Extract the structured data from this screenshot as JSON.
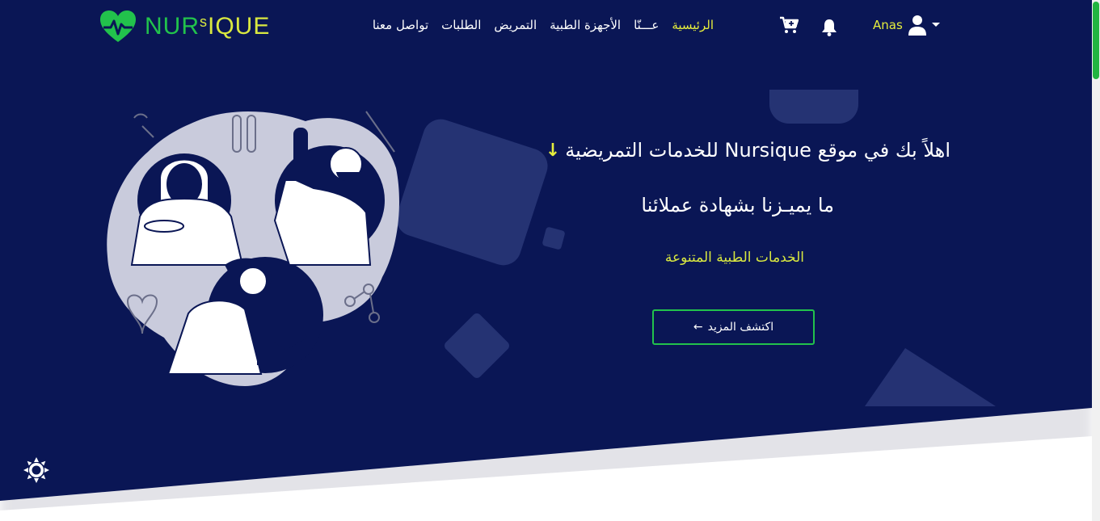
{
  "brand": {
    "name_part1": "NUR",
    "name_part2": "SIQUE",
    "name_s": "s"
  },
  "nav": {
    "links": [
      {
        "label": "الرئيسية",
        "active": true
      },
      {
        "label": "عـــنّا",
        "active": false
      },
      {
        "label": "الأجهزة الطبية",
        "active": false
      },
      {
        "label": "التمريض",
        "active": false
      },
      {
        "label": "الطلبات",
        "active": false
      },
      {
        "label": "تواصل معنا",
        "active": false
      }
    ],
    "cart_icon": "cart-plus-icon",
    "bell_icon": "bell-icon",
    "user_icon": "user-icon",
    "user_name": "Anas"
  },
  "hero": {
    "headline": "اهلاً بك في موقع Nursique للخدمات التمريضية",
    "subhead": "ما يميـزنا بشهادة عملائنا",
    "tagline": "الخدمات الطبية المتنوعة",
    "cta_label": "اكتشف المزيد",
    "cta_icon": "arrow-left-icon",
    "headline_icon": "arrow-down-icon"
  },
  "theme_toggle_icon": "sun-icon",
  "colors": {
    "background": "#0a1655",
    "accent_yellow": "#e6ee3c",
    "accent_green": "#22c24c"
  }
}
